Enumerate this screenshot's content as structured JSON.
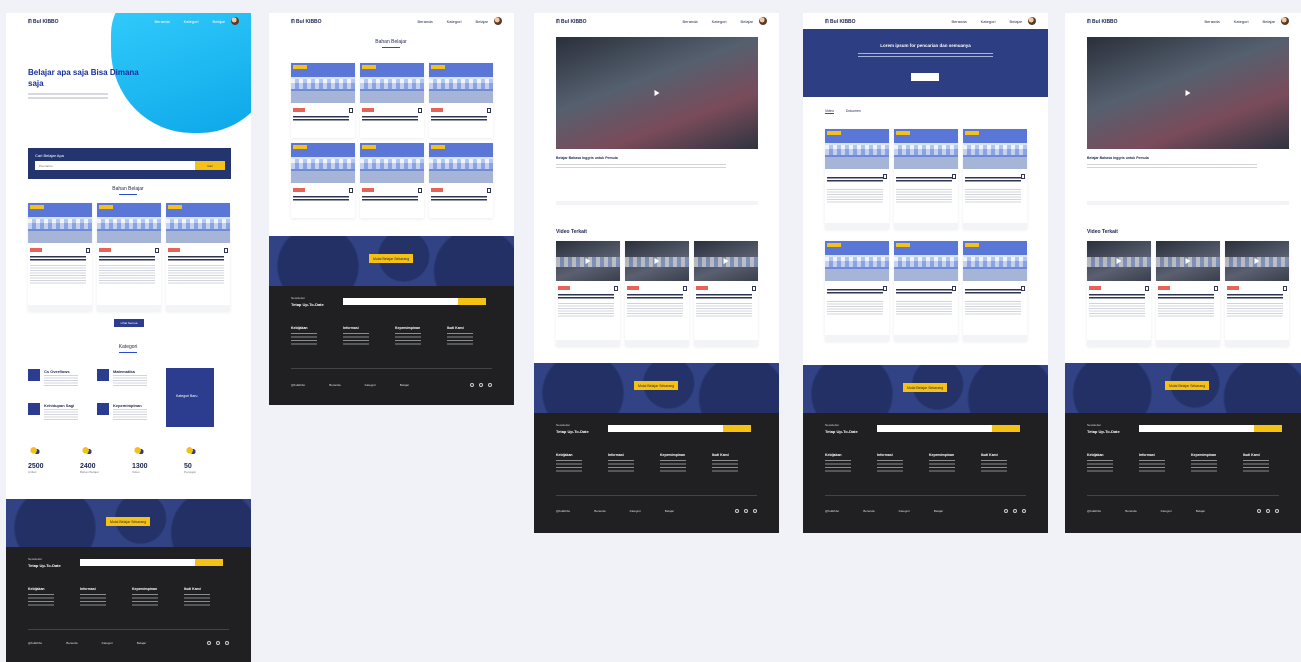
{
  "common": {
    "logo": "ᗰ Bul KIBBO",
    "nav": [
      "Beranda",
      "Kategori",
      "Belajar"
    ],
    "cta_button": "Mulai Belajar Sekarang",
    "newsletter_label": "Newsletter",
    "newsletter_title": "Tetap Up-To-Date",
    "footer_cols": [
      "Kebijakan",
      "Informasi",
      "Kepemimpinan",
      "Ikuti Kami"
    ],
    "footer_bottom": [
      "@bulkibbo",
      "Beranda",
      "Kategori",
      "Belajar"
    ]
  },
  "home": {
    "hero_title": "Belajar apa saja Bisa Dimana saja",
    "search_label": "Cari Belajar Apa",
    "search_placeholder": "Pencarian",
    "search_button": "Cari",
    "section_bahan": "Bahan Belajar",
    "more_button": "Lihat Semua",
    "section_kategori": "Kategori",
    "categories": [
      {
        "title": "Cs Overflows"
      },
      {
        "title": "Matematika"
      },
      {
        "title": "Kehidupan Sagi"
      },
      {
        "title": "Kepemimpinan"
      }
    ],
    "side_title": "Kategori Baru",
    "stats": [
      {
        "n": "2500",
        "k": "Artikel"
      },
      {
        "n": "2400",
        "k": "Bahan Belajar"
      },
      {
        "n": "1300",
        "k": "Video"
      },
      {
        "n": "50",
        "k": "Pengajar"
      }
    ]
  },
  "frame2": {
    "section_bahan": "Bahan Belajar"
  },
  "frame3": {
    "video_title": "Belajar Bahasa Inggris untuk Pemula",
    "section_video": "Video Terkait"
  },
  "frame4": {
    "hero_title": "Lorem ipsum for pencarian dan semuanya",
    "tabs": [
      "Video",
      "Dokumen"
    ]
  },
  "frame5": {
    "video_title": "Belajar Bahasa Inggris untuk Pemula",
    "section_video": "Video Terkait"
  }
}
